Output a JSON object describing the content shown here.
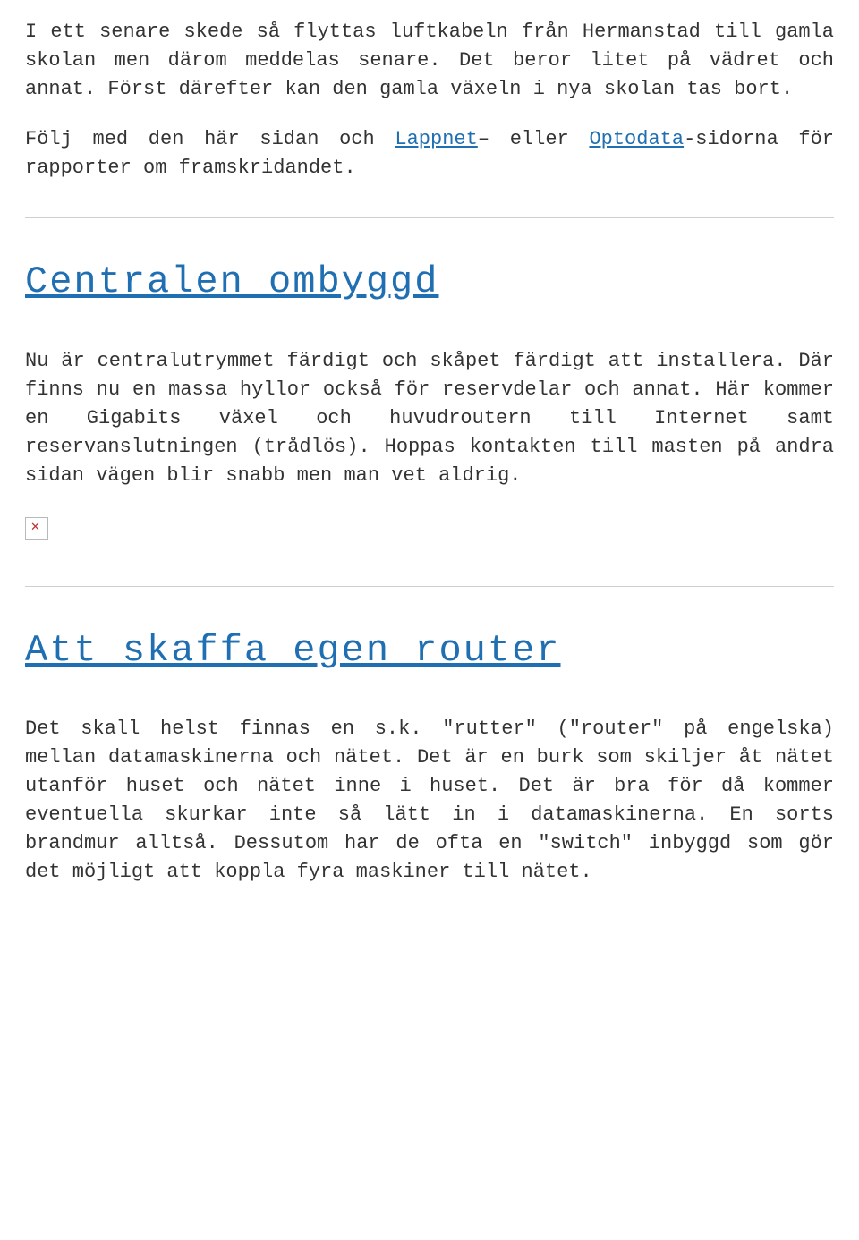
{
  "intro": {
    "p1_a": "I ett senare skede så flyttas luftkabeln från Hermanstad till gamla skolan men därom meddelas senare. Det beror litet på vädret och annat. Först därefter kan den gamla växeln i nya skolan tas bort.",
    "p2_a": "Följ med den här sidan och ",
    "p2_link1": "Lappnet",
    "p2_b": "– eller ",
    "p2_link2": "Optodata",
    "p2_c": "-sidorna för rapporter om framskridandet."
  },
  "post1": {
    "title": "Centralen ombyggd",
    "body": "Nu är centralutrymmet färdigt och skåpet färdigt att installera. Där finns nu en massa hyllor också för reservdelar och annat. Här kommer en Gigabits växel och huvudroutern till Internet samt reservanslutningen (trådlös). Hoppas kontakten till masten på andra sidan vägen blir snabb men man vet aldrig."
  },
  "post2": {
    "title": "Att skaffa egen router",
    "body": "Det skall helst finnas en s.k. \"rutter\" (\"router\" på engelska) mellan datamaskinerna och nätet. Det är en burk som skiljer åt nätet utanför huset och nätet inne i huset. Det är bra för då kommer eventuella skurkar inte så lätt in i datamaskinerna. En sorts brandmur alltså. Dessutom har de ofta en \"switch\" inbyggd som gör det möjligt att koppla fyra maskiner till nätet."
  }
}
